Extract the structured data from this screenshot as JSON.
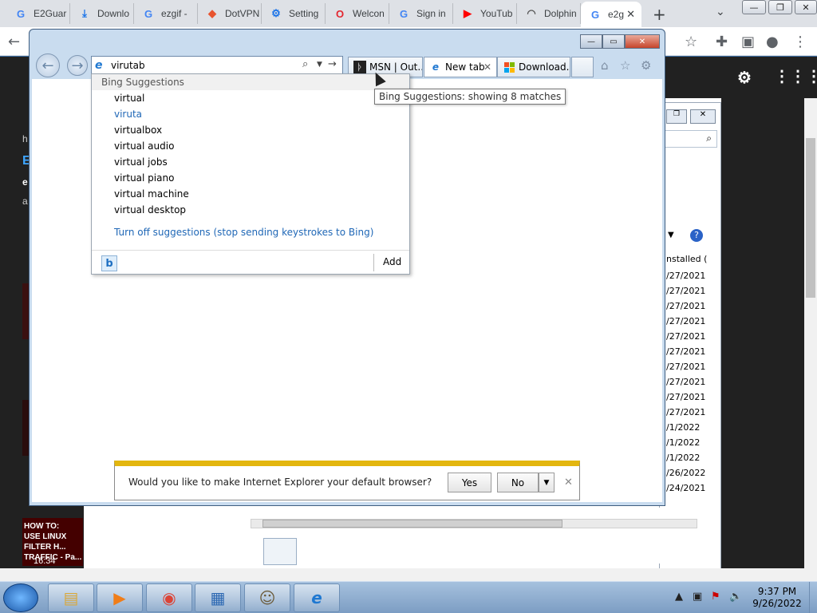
{
  "chrome": {
    "tabs": [
      {
        "label": "E2Guar",
        "icon": "google-icon"
      },
      {
        "label": "Downlo",
        "icon": "download-icon"
      },
      {
        "label": "ezgif -",
        "icon": "google-icon"
      },
      {
        "label": "DotVPN",
        "icon": "dotvpn-icon"
      },
      {
        "label": "Setting",
        "icon": "gear-icon"
      },
      {
        "label": "Welcon",
        "icon": "opera-icon"
      },
      {
        "label": "Sign in",
        "icon": "google-icon"
      },
      {
        "label": "YouTub",
        "icon": "youtube-icon"
      },
      {
        "label": "Dolphin",
        "icon": "dolphin-icon"
      },
      {
        "label": "e2g",
        "icon": "google-icon"
      }
    ]
  },
  "youtube": {
    "side_letters": [
      "h",
      "E",
      "e",
      "a"
    ],
    "thumb_caption": "HOW TO:\nUSE LINUX\nFILTER H...\nTRAFFIC - Pa...",
    "thumb_duration": "16:34"
  },
  "background_window": {
    "column_header": "nstalled (",
    "dates": [
      "/27/2021",
      "/27/2021",
      "/27/2021",
      "/27/2021",
      "/27/2021",
      "/27/2021",
      "/27/2021",
      "/27/2021",
      "/27/2021",
      "/27/2021",
      "/1/2022",
      "/1/2022",
      "/1/2022",
      "/26/2022",
      "/24/2021"
    ]
  },
  "ie": {
    "address_value": "virutab",
    "tabs": [
      {
        "label": "MSN | Out...",
        "icon": "msn-icon"
      },
      {
        "label": "New tab",
        "icon": "ie-icon"
      },
      {
        "label": "Download...",
        "icon": "windows-icon"
      }
    ],
    "suggestions": {
      "header": "Bing Suggestions",
      "items": [
        "virtual",
        "viruta",
        "virtualbox",
        "virtual audio",
        "virtual jobs",
        "virtual piano",
        "virtual machine",
        "virtual desktop"
      ],
      "highlighted_index": 1,
      "turn_off": "Turn off suggestions (stop sending keystrokes to Bing)",
      "add_label": "Add"
    },
    "tooltip": "Bing Suggestions: showing 8 matches",
    "notification": {
      "text": "Would you like to make Internet Explorer your default browser?",
      "yes": "Yes",
      "no": "No"
    }
  },
  "taskbar": {
    "time": "9:37 PM",
    "date": "9/26/2022"
  }
}
